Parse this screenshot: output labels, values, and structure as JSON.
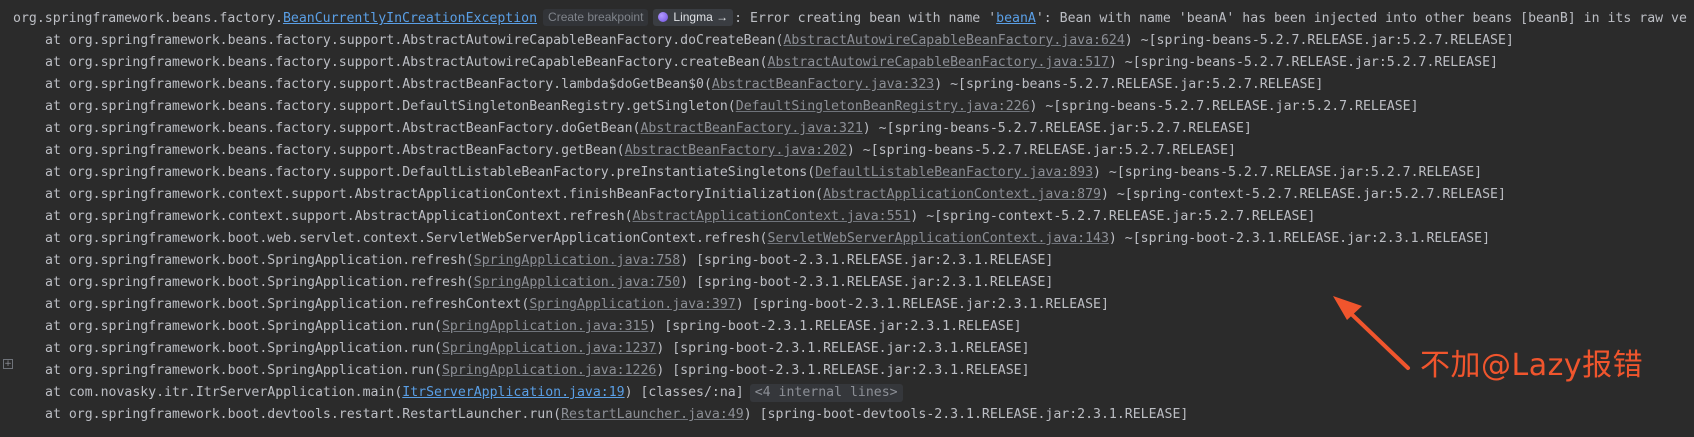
{
  "console": {
    "exception": {
      "prefix": "org.springframework.beans.factory.",
      "class_link": "BeanCurrentlyInCreationException",
      "breakpoint_chip": "Create breakpoint",
      "lingma_chip": "Lingma →",
      "msg_before": ": Error creating bean with name '",
      "bean_link": "beanA",
      "msg_after": "': Bean with name 'beanA' has been injected into other beans [beanB] in its raw ve"
    },
    "frames": [
      {
        "method": "at org.springframework.beans.factory.support.AbstractAutowireCapableBeanFactory.doCreateBean(",
        "source": "AbstractAutowireCapableBeanFactory.java:624",
        "suffix": ") ~[spring-beans-5.2.7.RELEASE.jar:5.2.7.RELEASE]"
      },
      {
        "method": "at org.springframework.beans.factory.support.AbstractAutowireCapableBeanFactory.createBean(",
        "source": "AbstractAutowireCapableBeanFactory.java:517",
        "suffix": ") ~[spring-beans-5.2.7.RELEASE.jar:5.2.7.RELEASE]"
      },
      {
        "method": "at org.springframework.beans.factory.support.AbstractBeanFactory.lambda$doGetBean$0(",
        "source": "AbstractBeanFactory.java:323",
        "suffix": ") ~[spring-beans-5.2.7.RELEASE.jar:5.2.7.RELEASE]"
      },
      {
        "method": "at org.springframework.beans.factory.support.DefaultSingletonBeanRegistry.getSingleton(",
        "source": "DefaultSingletonBeanRegistry.java:226",
        "suffix": ") ~[spring-beans-5.2.7.RELEASE.jar:5.2.7.RELEASE]"
      },
      {
        "method": "at org.springframework.beans.factory.support.AbstractBeanFactory.doGetBean(",
        "source": "AbstractBeanFactory.java:321",
        "suffix": ") ~[spring-beans-5.2.7.RELEASE.jar:5.2.7.RELEASE]"
      },
      {
        "method": "at org.springframework.beans.factory.support.AbstractBeanFactory.getBean(",
        "source": "AbstractBeanFactory.java:202",
        "suffix": ") ~[spring-beans-5.2.7.RELEASE.jar:5.2.7.RELEASE]"
      },
      {
        "method": "at org.springframework.beans.factory.support.DefaultListableBeanFactory.preInstantiateSingletons(",
        "source": "DefaultListableBeanFactory.java:893",
        "suffix": ") ~[spring-beans-5.2.7.RELEASE.jar:5.2.7.RELEASE]"
      },
      {
        "method": "at org.springframework.context.support.AbstractApplicationContext.finishBeanFactoryInitialization(",
        "source": "AbstractApplicationContext.java:879",
        "suffix": ") ~[spring-context-5.2.7.RELEASE.jar:5.2.7.RELEASE]"
      },
      {
        "method": "at org.springframework.context.support.AbstractApplicationContext.refresh(",
        "source": "AbstractApplicationContext.java:551",
        "suffix": ") ~[spring-context-5.2.7.RELEASE.jar:5.2.7.RELEASE]"
      },
      {
        "method": "at org.springframework.boot.web.servlet.context.ServletWebServerApplicationContext.refresh(",
        "source": "ServletWebServerApplicationContext.java:143",
        "suffix": ") ~[spring-boot-2.3.1.RELEASE.jar:2.3.1.RELEASE]"
      },
      {
        "method": "at org.springframework.boot.SpringApplication.refresh(",
        "source": "SpringApplication.java:758",
        "suffix": ") [spring-boot-2.3.1.RELEASE.jar:2.3.1.RELEASE]"
      },
      {
        "method": "at org.springframework.boot.SpringApplication.refresh(",
        "source": "SpringApplication.java:750",
        "suffix": ") [spring-boot-2.3.1.RELEASE.jar:2.3.1.RELEASE]"
      },
      {
        "method": "at org.springframework.boot.SpringApplication.refreshContext(",
        "source": "SpringApplication.java:397",
        "suffix": ") [spring-boot-2.3.1.RELEASE.jar:2.3.1.RELEASE]"
      },
      {
        "method": "at org.springframework.boot.SpringApplication.run(",
        "source": "SpringApplication.java:315",
        "suffix": ") [spring-boot-2.3.1.RELEASE.jar:2.3.1.RELEASE]"
      },
      {
        "method": "at org.springframework.boot.SpringApplication.run(",
        "source": "SpringApplication.java:1237",
        "suffix": ") [spring-boot-2.3.1.RELEASE.jar:2.3.1.RELEASE]"
      },
      {
        "method": "at org.springframework.boot.SpringApplication.run(",
        "source": "SpringApplication.java:1226",
        "suffix": ") [spring-boot-2.3.1.RELEASE.jar:2.3.1.RELEASE]"
      },
      {
        "method": "at com.novasky.itr.ItrServerApplication.main(",
        "source": "ItrServerApplication.java:19",
        "suffix": ") [classes/:na]",
        "fold_chip": "<4 internal lines>",
        "project": true
      },
      {
        "method": "at org.springframework.boot.devtools.restart.RestartLauncher.run(",
        "source": "RestartLauncher.java:49",
        "suffix": ") [spring-boot-devtools-2.3.1.RELEASE.jar:2.3.1.RELEASE]"
      }
    ],
    "gutter_fold_symbol": "+"
  },
  "annotation": {
    "text": "不加@Lazy报错",
    "color": "#f0552d"
  },
  "colors": {
    "background": "#2b2b2b",
    "text": "#bcbec4",
    "link": "#8c8f96",
    "project_link": "#5a9fe6"
  }
}
